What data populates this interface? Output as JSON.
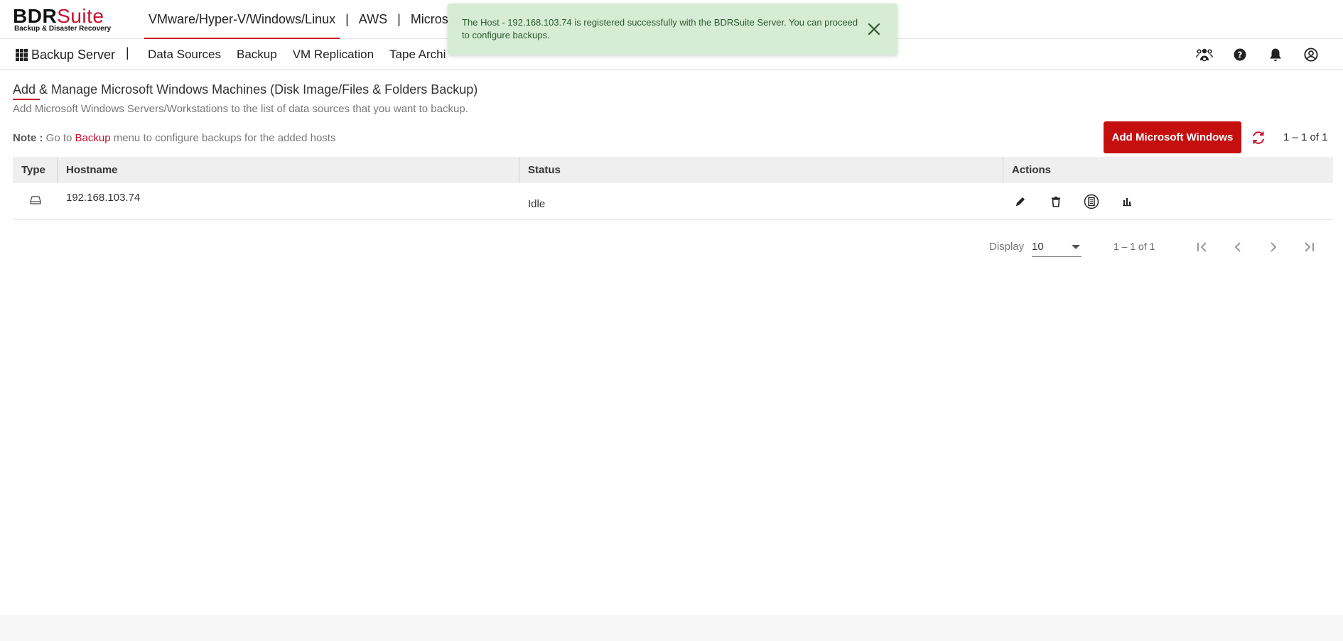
{
  "brand": {
    "name_primary": "BDR",
    "name_accent": "Suite",
    "tagline": "Backup & Disaster Recovery"
  },
  "product_nav": [
    {
      "label": "VMware/Hyper-V/Windows/Linux",
      "active": true
    },
    {
      "label": "AWS",
      "active": false
    },
    {
      "label": "Microso",
      "active": false
    }
  ],
  "product_nav_sep": "|",
  "subnav": {
    "apps_label": "Backup Server",
    "separator": "|",
    "items": [
      "Data Sources",
      "Backup",
      "VM Replication",
      "Tape Archi"
    ]
  },
  "toolbar_icons": [
    "users-icon",
    "help-icon",
    "bell-icon",
    "account-icon"
  ],
  "toast": {
    "message": "The Host - 192.168.103.74 is registered successfully with the BDRSuite Server. You can proceed to configure backups.",
    "color": "#d6ecd5"
  },
  "page": {
    "title": "Add & Manage Microsoft Windows Machines (Disk Image/Files & Folders Backup)",
    "subtitle": "Add Microsoft Windows Servers/Workstations to the list of data sources that you want to backup.",
    "note_label": "Note :",
    "note_pre": "Go to",
    "note_link": "Backup",
    "note_post": "menu to configure backups for the added hosts",
    "add_button": "Add Microsoft Windows",
    "range_text": "1 – 1 of 1"
  },
  "table": {
    "columns": [
      "Type",
      "Hostname",
      "Status",
      "Actions"
    ],
    "rows": [
      {
        "type_icon": "disk-icon",
        "hostname": "192.168.103.74",
        "status": "Idle",
        "actions": [
          "edit-icon",
          "delete-icon",
          "report-icon",
          "chart-icon"
        ]
      }
    ]
  },
  "pagination": {
    "display_label": "Display",
    "page_size": "10",
    "range": "1 – 1 of 1"
  },
  "colors": {
    "accent": "#c8102e",
    "button": "#c50f0f",
    "toast_bg": "#d6ecd5"
  }
}
